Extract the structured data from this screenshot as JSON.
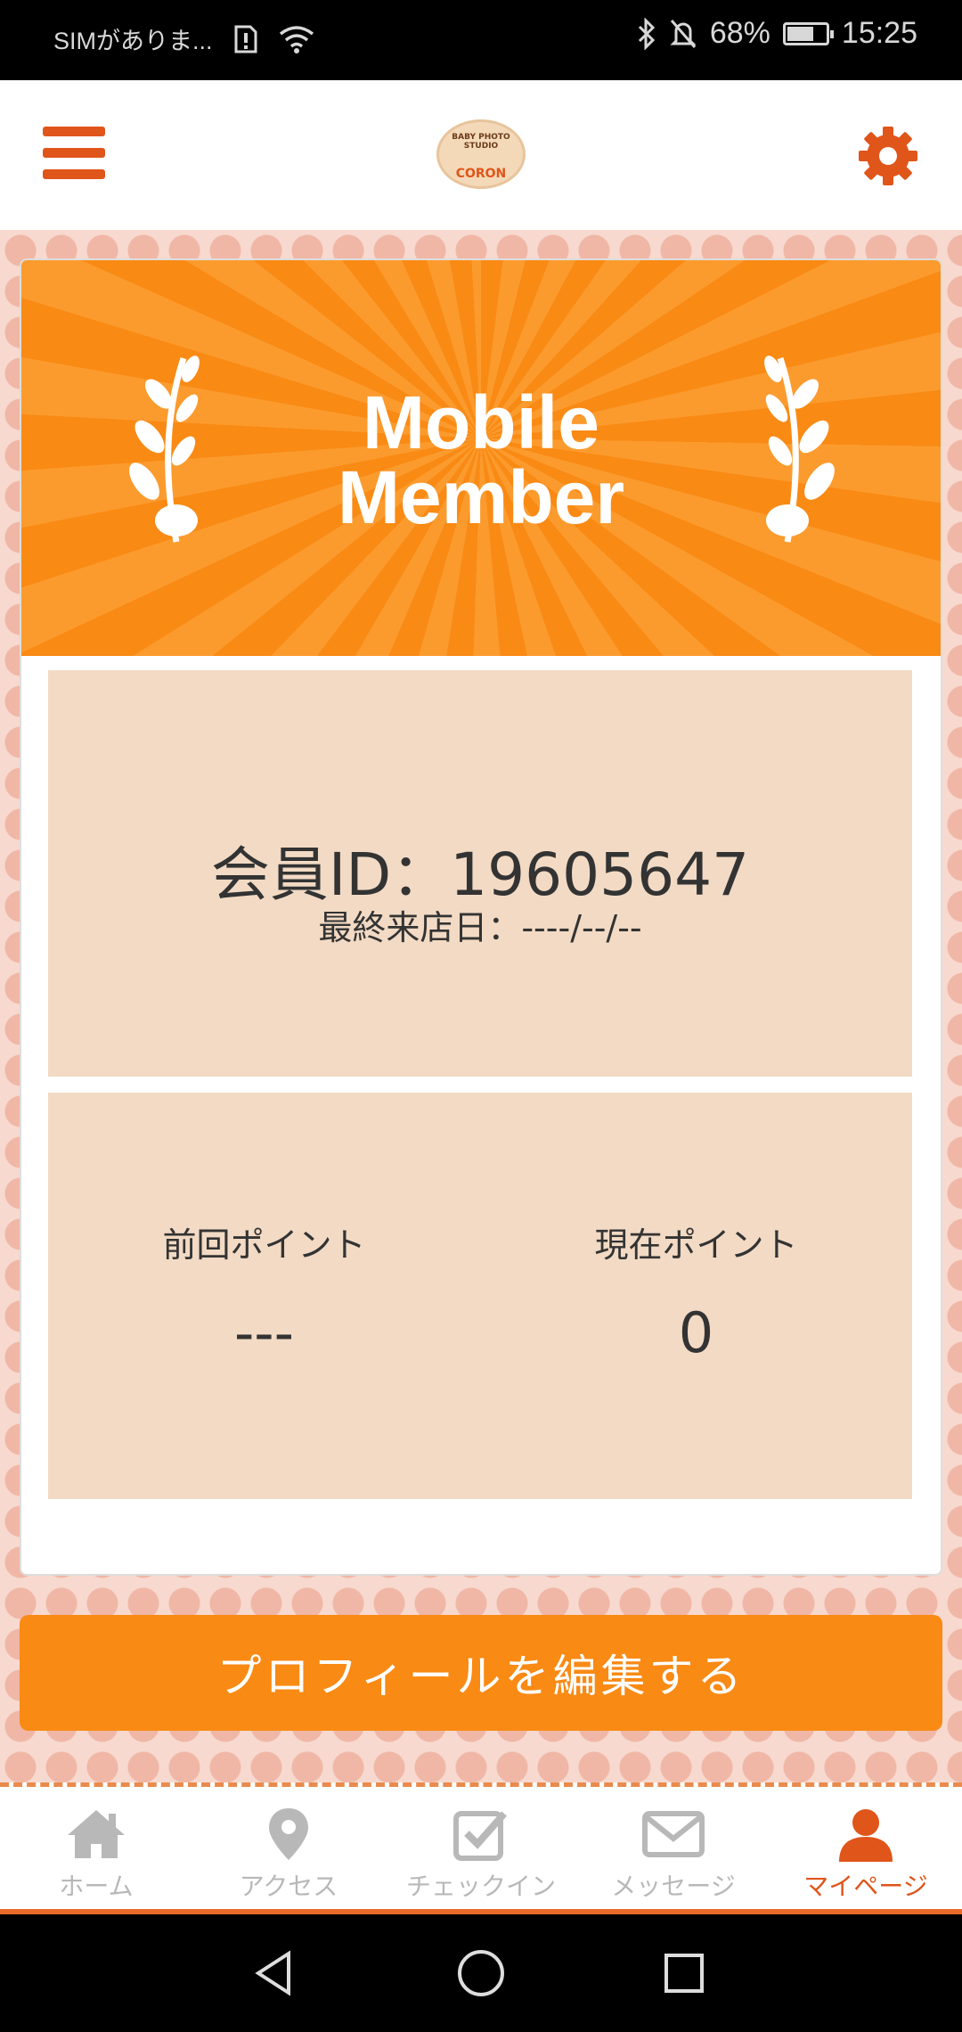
{
  "status_bar": {
    "carrier": "SIMがありま...",
    "battery": "68%",
    "battery_level": 0.68,
    "time": "15:25"
  },
  "app_bar": {
    "logo_top": "BABY PHOTO STUDIO",
    "logo_name": "CORON",
    "menu_icon": "hamburger-icon",
    "settings_icon": "gear-icon"
  },
  "banner": {
    "line1": "Mobile",
    "line2": "Member"
  },
  "member": {
    "id_text": "会員ID：19605647",
    "last_visit_text": "最終来店日：----/--/--"
  },
  "points": {
    "previous_label": "前回ポイント",
    "previous_value": "---",
    "current_label": "現在ポイント",
    "current_value": "0"
  },
  "edit_button": "プロフィールを編集する",
  "tabs": [
    {
      "label": "ホーム",
      "icon": "home-icon",
      "active": false
    },
    {
      "label": "アクセス",
      "icon": "map-pin-icon",
      "active": false
    },
    {
      "label": "チェックイン",
      "icon": "checkbox-icon",
      "active": false
    },
    {
      "label": "メッセージ",
      "icon": "mail-icon",
      "active": false
    },
    {
      "label": "マイページ",
      "icon": "person-icon",
      "active": true
    }
  ],
  "colors": {
    "accent": "#e0551a",
    "banner_orange": "#f98a14",
    "panel": "#f2dac4"
  }
}
